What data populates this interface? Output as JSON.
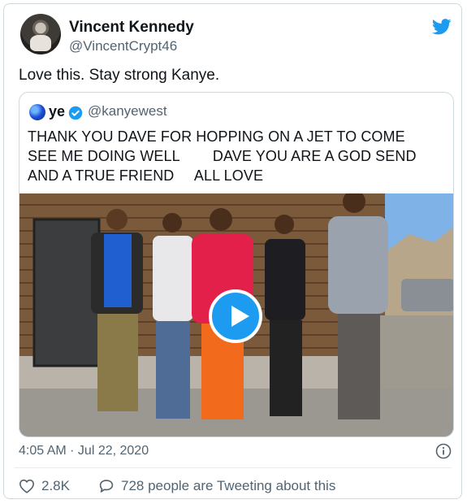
{
  "author": {
    "name": "Vincent Kennedy",
    "handle": "@VincentCrypt46"
  },
  "tweet_text": "Love this. Stay strong Kanye.",
  "quoted": {
    "name": "ye",
    "handle": "@kanyewest",
    "text": "THANK YOU DAVE FOR HOPPING ON A JET TO COME\nSEE ME DOING WELL        DAVE YOU ARE A GOD SEND\nAND A TRUE FRIEND     ALL LOVE"
  },
  "timestamp": "4:05 AM · Jul 22, 2020",
  "stats": {
    "likes": "2.8K",
    "talking": "728 people are Tweeting about this"
  },
  "icons": {
    "bird": "twitter-bird-icon",
    "verified": "verified-badge-icon",
    "play": "play-icon",
    "info": "info-icon",
    "heart": "heart-icon",
    "comment": "comment-bubble-icon"
  },
  "colors": {
    "accent": "#1d9bf0",
    "muted": "#536471",
    "text": "#0f1419"
  }
}
